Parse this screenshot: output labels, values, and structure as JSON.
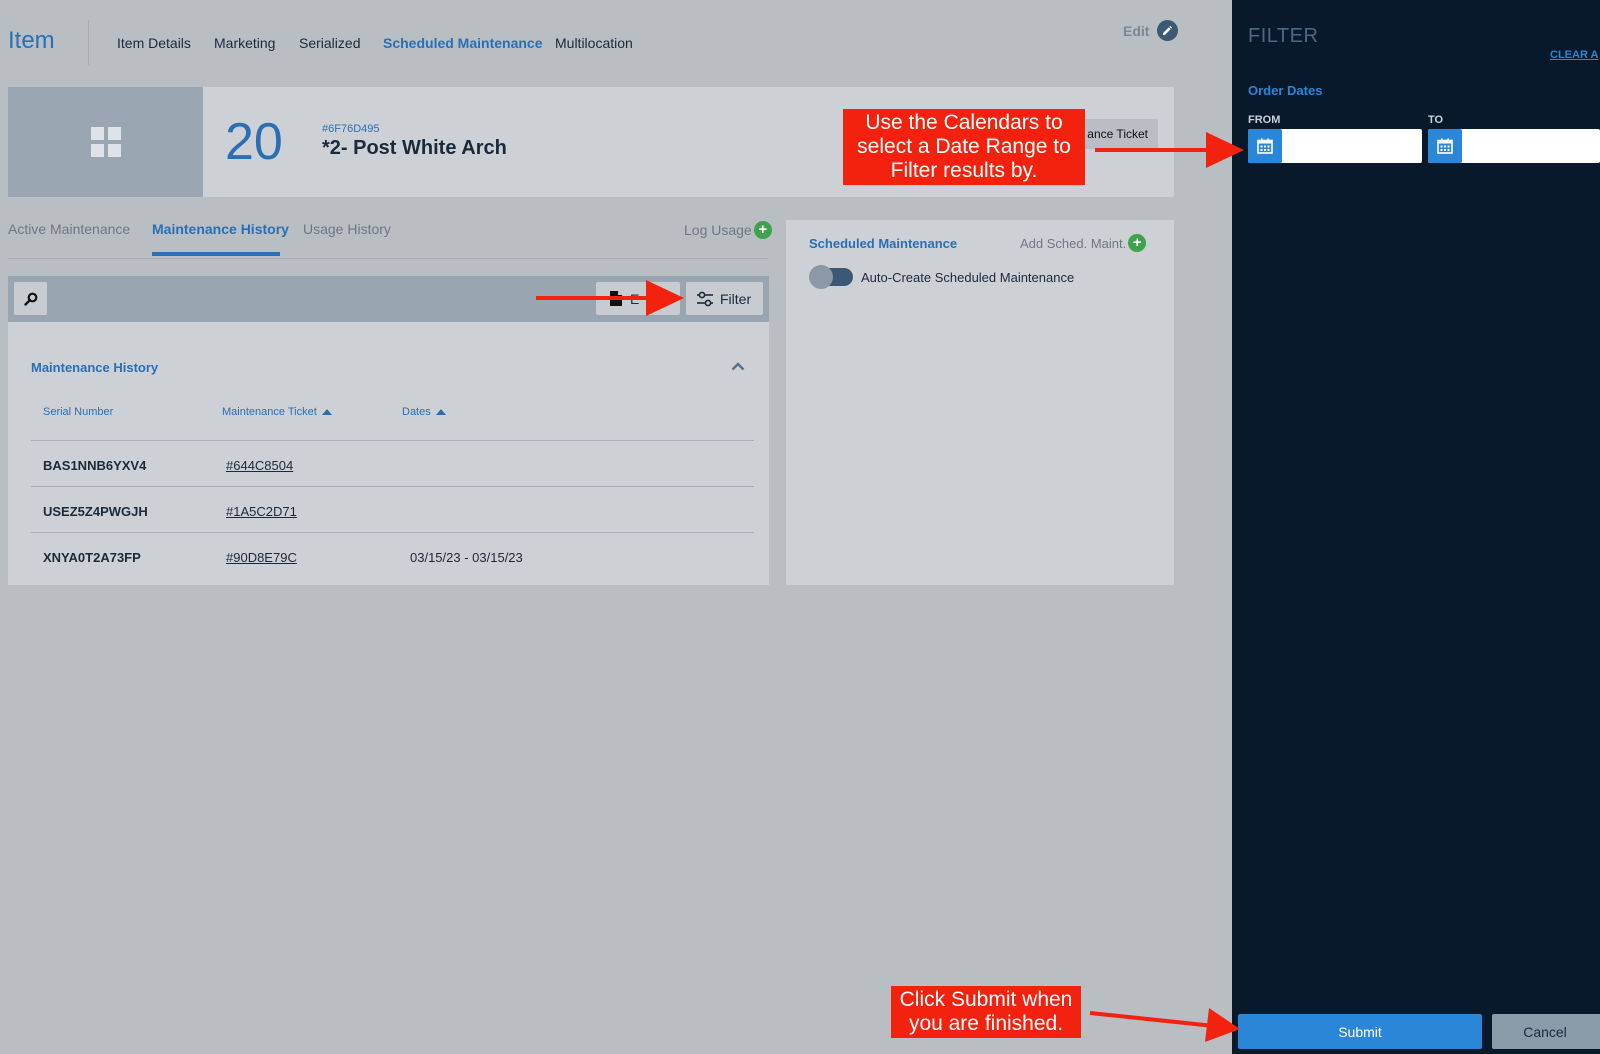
{
  "nav": {
    "title": "Item",
    "links": [
      "Item Details",
      "Marketing",
      "Serialized",
      "Scheduled Maintenance",
      "Multilocation"
    ],
    "edit_label": "Edit"
  },
  "item": {
    "quantity": "20",
    "id": "#6F76D495",
    "name": "*2- Post White Arch",
    "ticket_button": "ance Ticket"
  },
  "subtabs": {
    "items": [
      "Active Maintenance",
      "Maintenance History",
      "Usage History"
    ],
    "log_usage": "Log Usage"
  },
  "toolbar": {
    "export_label": "E",
    "filter_label": "Filter"
  },
  "history": {
    "title": "Maintenance History",
    "columns": [
      "Serial Number",
      "Maintenance Ticket",
      "Dates"
    ],
    "rows": [
      {
        "serial": "BAS1NNB6YXV4",
        "ticket": "#644C8504",
        "dates": ""
      },
      {
        "serial": "USEZ5Z4PWGJH",
        "ticket": "#1A5C2D71",
        "dates": ""
      },
      {
        "serial": "XNYA0T2A73FP",
        "ticket": "#90D8E79C",
        "dates": "03/15/23 - 03/15/23"
      }
    ]
  },
  "scheduled": {
    "title": "Scheduled Maintenance",
    "add_label": "Add Sched. Maint.",
    "toggle_label": "Auto-Create Scheduled Maintenance",
    "toggle_on": false
  },
  "filter": {
    "title": "FILTER",
    "clear_all": "CLEAR A",
    "section_title": "Order Dates",
    "from_label": "FROM",
    "to_label": "TO",
    "from_value": "",
    "to_value": "",
    "submit_label": "Submit",
    "cancel_label": "Cancel"
  },
  "annotations": {
    "calendar_note": "Use the Calendars to select a Date Range to Filter results by.",
    "submit_note": "Click Submit when you are finished."
  },
  "colors": {
    "accent": "#2a6fb5",
    "drawer_bg": "#07192a",
    "callout_red": "#f2220f",
    "add_green": "#3fa34d"
  }
}
